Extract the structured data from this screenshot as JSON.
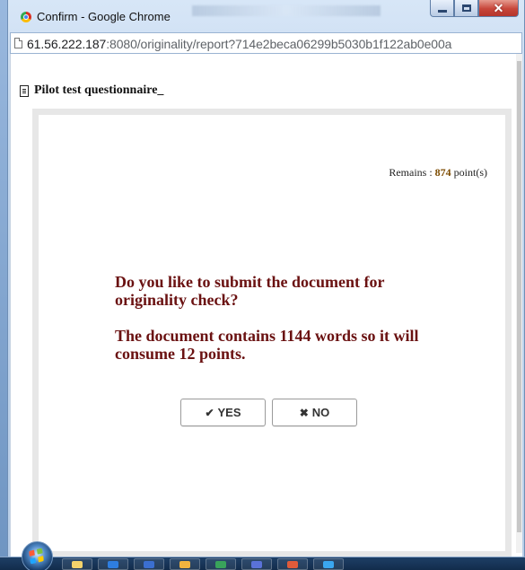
{
  "window": {
    "title": "Confirm - Google Chrome",
    "controls": {
      "minimize_icon": "minimize-icon",
      "maximize_icon": "maximize-icon",
      "close_icon": "close-icon"
    }
  },
  "address_bar": {
    "host": "61.56.222.187",
    "rest": ":8080/originality/report?714e2beca06299b5030b1f122ab0e00a",
    "icon": "document-icon"
  },
  "page": {
    "header_title": "Pilot test questionnaire_",
    "header_icon": "document-icon",
    "remains_label": "Remains :",
    "remains_value": "874",
    "remains_unit": "point(s)",
    "message_line1": "Do you like to submit the document for originality check?",
    "message_line2": "The document contains 1144 words so it will consume 12 points.",
    "yes_button_label": "YES",
    "yes_button_icon": "check-icon",
    "no_button_label": "NO",
    "no_button_icon": "x-icon"
  },
  "taskbar": {
    "start_icon": "windows-start-icon",
    "apps": [
      {
        "name": "folder-icon",
        "color": "#f4d36b"
      },
      {
        "name": "outlook-icon",
        "color": "#2e7ee0"
      },
      {
        "name": "word-icon",
        "color": "#3b6fd0"
      },
      {
        "name": "chrome-icon",
        "color": "#f1b33f"
      },
      {
        "name": "excel-icon",
        "color": "#39a35b"
      },
      {
        "name": "teams-icon",
        "color": "#5a72d8"
      },
      {
        "name": "powerpoint-icon",
        "color": "#e05b3a"
      },
      {
        "name": "ie-icon",
        "color": "#3aa7f0"
      }
    ]
  },
  "colors": {
    "message_text": "#6a1111",
    "remains_value": "#7c4b00",
    "close_button": "#c7463a",
    "titlebar": "#c4d8ef"
  }
}
